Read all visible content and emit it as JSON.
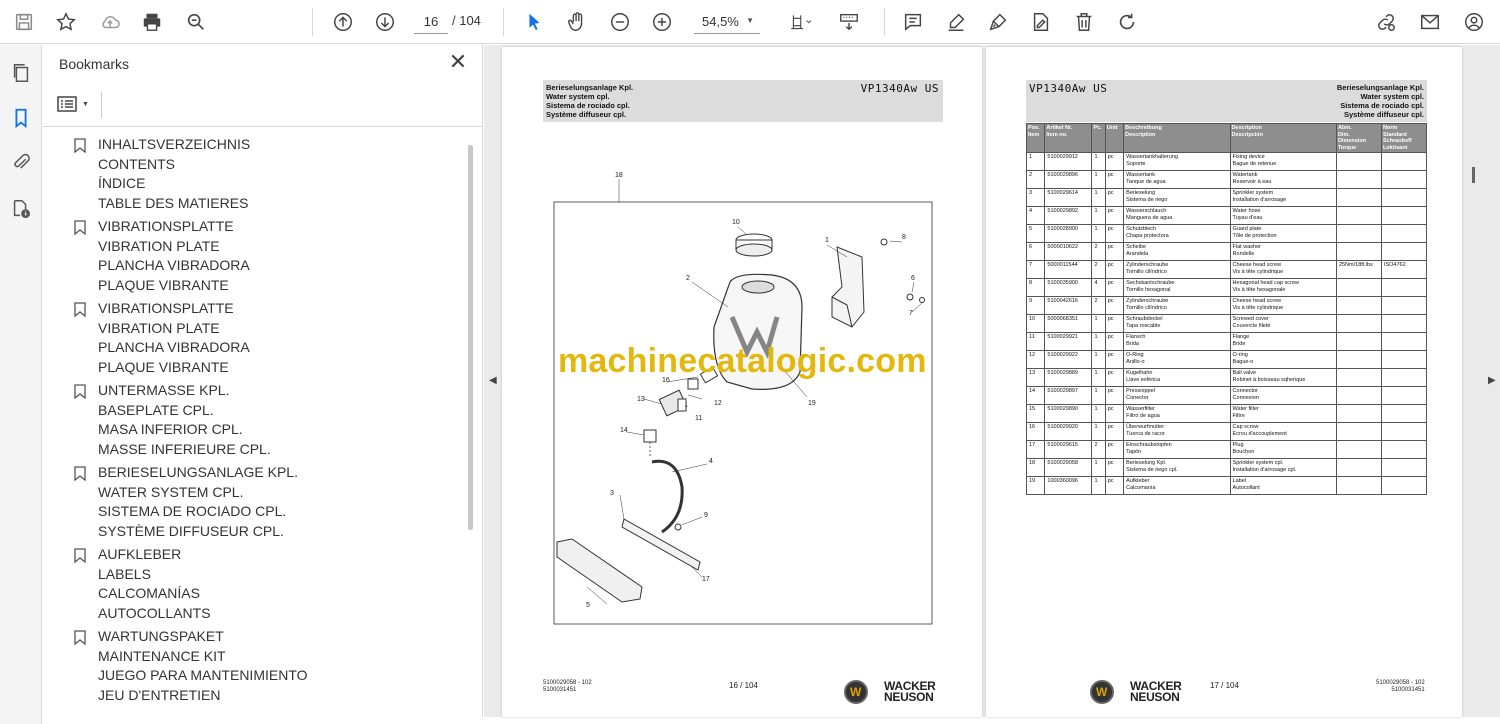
{
  "toolbar": {
    "current_page": "16",
    "page_total": "/ 104",
    "zoom": "54,5%"
  },
  "bookmarks": {
    "title": "Bookmarks",
    "close": "✕",
    "items": [
      {
        "lines": [
          "INHALTSVERZEICHNIS",
          "CONTENTS",
          "ÍNDICE",
          "TABLE DES MATIERES"
        ]
      },
      {
        "lines": [
          "VIBRATIONSPLATTE",
          "VIBRATION PLATE",
          "PLANCHA VIBRADORA",
          "PLAQUE VIBRANTE"
        ]
      },
      {
        "lines": [
          "VIBRATIONSPLATTE",
          "VIBRATION PLATE",
          "PLANCHA VIBRADORA",
          "PLAQUE VIBRANTE"
        ]
      },
      {
        "lines": [
          "UNTERMASSE KPL.",
          "BASEPLATE CPL.",
          "MASA INFERIOR CPL.",
          "MASSE INFERIEURE CPL."
        ]
      },
      {
        "lines": [
          "BERIESELUNGSANLAGE KPL.",
          "WATER SYSTEM CPL.",
          "SISTEMA DE ROCIADO CPL.",
          "SYSTÈME DIFFUSEUR CPL."
        ]
      },
      {
        "lines": [
          "AUFKLEBER",
          "LABELS",
          "CALCOMANÍAS",
          "AUTOCOLLANTS"
        ]
      },
      {
        "lines": [
          "WARTUNGSPAKET",
          "MAINTENANCE KIT",
          "JUEGO PARA MANTENIMIENTO",
          "JEU D'ENTRETIEN"
        ]
      }
    ]
  },
  "page_left": {
    "header_lines": [
      "Berieselungsanlage Kpl.",
      "Water system cpl.",
      "Sistema de rociado cpl.",
      "Système diffuseur cpl."
    ],
    "model": "VP1340Aw US",
    "callouts": [
      "18",
      "10",
      "1",
      "8",
      "2",
      "6",
      "7",
      "19",
      "16",
      "13",
      "12",
      "11",
      "14",
      "4",
      "3",
      "9",
      "17",
      "5"
    ],
    "doc_no": "5100029058 - 102",
    "doc_no2": "5100031451",
    "page_no": "16 / 104",
    "brand_1": "WACKER",
    "brand_2": "NEUSON"
  },
  "page_right": {
    "model": "VP1340Aw US",
    "header_lines": [
      "Berieselungsanlage Kpl.",
      "Water system cpl.",
      "Sistema de rociado cpl.",
      "Système diffuseur cpl."
    ],
    "table_headers": {
      "pos": [
        "Pos.",
        "Item"
      ],
      "art": [
        "Artikel Nr.",
        "Item no."
      ],
      "pc": [
        "Pc."
      ],
      "unit": [
        "Unit"
      ],
      "d1": [
        "Beschreibung",
        "Description"
      ],
      "d2": [
        "Description",
        "Descripción"
      ],
      "dim": [
        "Abm.",
        "Dim.",
        "Dimension",
        "Torque"
      ],
      "std": [
        "Norm",
        "Standard",
        "Schraubsff",
        "Loktisant"
      ]
    },
    "rows": [
      {
        "pos": "1",
        "art": "5100029912",
        "pc": "1",
        "unit": "pc",
        "d1": [
          "Wassertankhalterung",
          "Soporte"
        ],
        "d2": [
          "Fixing device",
          "Bague de retenue"
        ],
        "dim": "",
        "std": ""
      },
      {
        "pos": "2",
        "art": "5100029896",
        "pc": "1",
        "unit": "pc",
        "d1": [
          "Wassertank",
          "Tanque de agua"
        ],
        "d2": [
          "Watertank",
          "Reservoir à eau"
        ],
        "dim": "",
        "std": ""
      },
      {
        "pos": "3",
        "art": "5100029614",
        "pc": "1",
        "unit": "pc",
        "d1": [
          "Berieselung",
          "Sistema de riego"
        ],
        "d2": [
          "Sprinkler system",
          "Installation d'arrosage"
        ],
        "dim": "",
        "std": ""
      },
      {
        "pos": "4",
        "art": "5100029892",
        "pc": "1",
        "unit": "pc",
        "d1": [
          "Wasserschlauch",
          "Manguera de agua"
        ],
        "d2": [
          "Water hose",
          "Tuyau d'eau"
        ],
        "dim": "",
        "std": ""
      },
      {
        "pos": "5",
        "art": "5100028900",
        "pc": "1",
        "unit": "pc",
        "d1": [
          "Schutzblech",
          "Chapa protectora"
        ],
        "d2": [
          "Guard plate",
          "Tôle de protection"
        ],
        "dim": "",
        "std": ""
      },
      {
        "pos": "6",
        "art": "5000010622",
        "pc": "2",
        "unit": "pc",
        "d1": [
          "Scheibe",
          "Arandela"
        ],
        "d2": [
          "Flat washer",
          "Rondelle"
        ],
        "dim": "",
        "std": ""
      },
      {
        "pos": "7",
        "art": "5000011544",
        "pc": "2",
        "unit": "pc",
        "d1": [
          "Zylinderschraube",
          "Tornillo cilíndrico"
        ],
        "d2": [
          "Cheese head screw",
          "Vis à tête cylindrique"
        ],
        "dim": "25Nm/18ft.lbs",
        "std": "ISO4762"
      },
      {
        "pos": "8",
        "art": "5100035900",
        "pc": "4",
        "unit": "pc",
        "d1": [
          "Sechskantschraube",
          "Tornillo hexagonal"
        ],
        "d2": [
          "Hexagonal head cap screw",
          "Vis à tête hexagonale"
        ],
        "dim": "",
        "std": ""
      },
      {
        "pos": "9",
        "art": "5100042616",
        "pc": "2",
        "unit": "pc",
        "d1": [
          "Zylinderschraube",
          "Tornillo cilíndrico"
        ],
        "d2": [
          "Cheese head screw",
          "Vis à tête cylindrique"
        ],
        "dim": "",
        "std": ""
      },
      {
        "pos": "10",
        "art": "5000068351",
        "pc": "1",
        "unit": "pc",
        "d1": [
          "Schraubdeckel",
          "Tapa roscable"
        ],
        "d2": [
          "Screwed cover",
          "Couvercle fileté"
        ],
        "dim": "",
        "std": ""
      },
      {
        "pos": "11",
        "art": "5100029921",
        "pc": "1",
        "unit": "pc",
        "d1": [
          "Flansch",
          "Brida"
        ],
        "d2": [
          "Flange",
          "Bride"
        ],
        "dim": "",
        "std": ""
      },
      {
        "pos": "12",
        "art": "5100029922",
        "pc": "1",
        "unit": "pc",
        "d1": [
          "O-Ring",
          "Anillo-o"
        ],
        "d2": [
          "O-ring",
          "Bague-o"
        ],
        "dim": "",
        "std": ""
      },
      {
        "pos": "13",
        "art": "5100029889",
        "pc": "1",
        "unit": "pc",
        "d1": [
          "Kugelhahn",
          "Llave esférica"
        ],
        "d2": [
          "Ball valve",
          "Robinet à boisseau sqherique"
        ],
        "dim": "",
        "std": ""
      },
      {
        "pos": "14",
        "art": "5100029897",
        "pc": "1",
        "unit": "pc",
        "d1": [
          "Pressnippel",
          "Conector"
        ],
        "d2": [
          "Connector",
          "Connexion"
        ],
        "dim": "",
        "std": ""
      },
      {
        "pos": "15",
        "art": "5100029890",
        "pc": "1",
        "unit": "pc",
        "d1": [
          "Wasserfilter",
          "Filtro de agua"
        ],
        "d2": [
          "Water filter",
          "Filtre"
        ],
        "dim": "",
        "std": ""
      },
      {
        "pos": "16",
        "art": "5100029920",
        "pc": "1",
        "unit": "pc",
        "d1": [
          "Überwurfmutter",
          "Tuerca de racor"
        ],
        "d2": [
          "Cap screw",
          "Ecrou d'accouplement"
        ],
        "dim": "",
        "std": ""
      },
      {
        "pos": "17",
        "art": "5100029615",
        "pc": "2",
        "unit": "pc",
        "d1": [
          "Einschraubstopfen",
          "Tapón"
        ],
        "d2": [
          "Plug",
          "Bouchon"
        ],
        "dim": "",
        "std": ""
      },
      {
        "pos": "18",
        "art": "5100029058",
        "pc": "1",
        "unit": "pc",
        "d1": [
          "Berieselung Kpl.",
          "Sistema de riego cpl."
        ],
        "d2": [
          "Sprinkler system cpl.",
          "Installation d'arrosage cpl."
        ],
        "dim": "",
        "std": ""
      },
      {
        "pos": "19",
        "art": "1000360096",
        "pc": "1",
        "unit": "pc",
        "d1": [
          "Aufkleber",
          "Calcomanía"
        ],
        "d2": [
          "Label",
          "Autocollant"
        ],
        "dim": "",
        "std": ""
      }
    ],
    "page_no": "17 / 104",
    "doc_no": "5100029058 - 102",
    "doc_no2": "5100031451",
    "brand_1": "WACKER",
    "brand_2": "NEUSON"
  },
  "watermark": "machinecatalogic.com",
  "colors": {
    "watermark": "#e2b80f",
    "toolbar_active": "#1473e6",
    "table_header": "#8e8e8e"
  }
}
